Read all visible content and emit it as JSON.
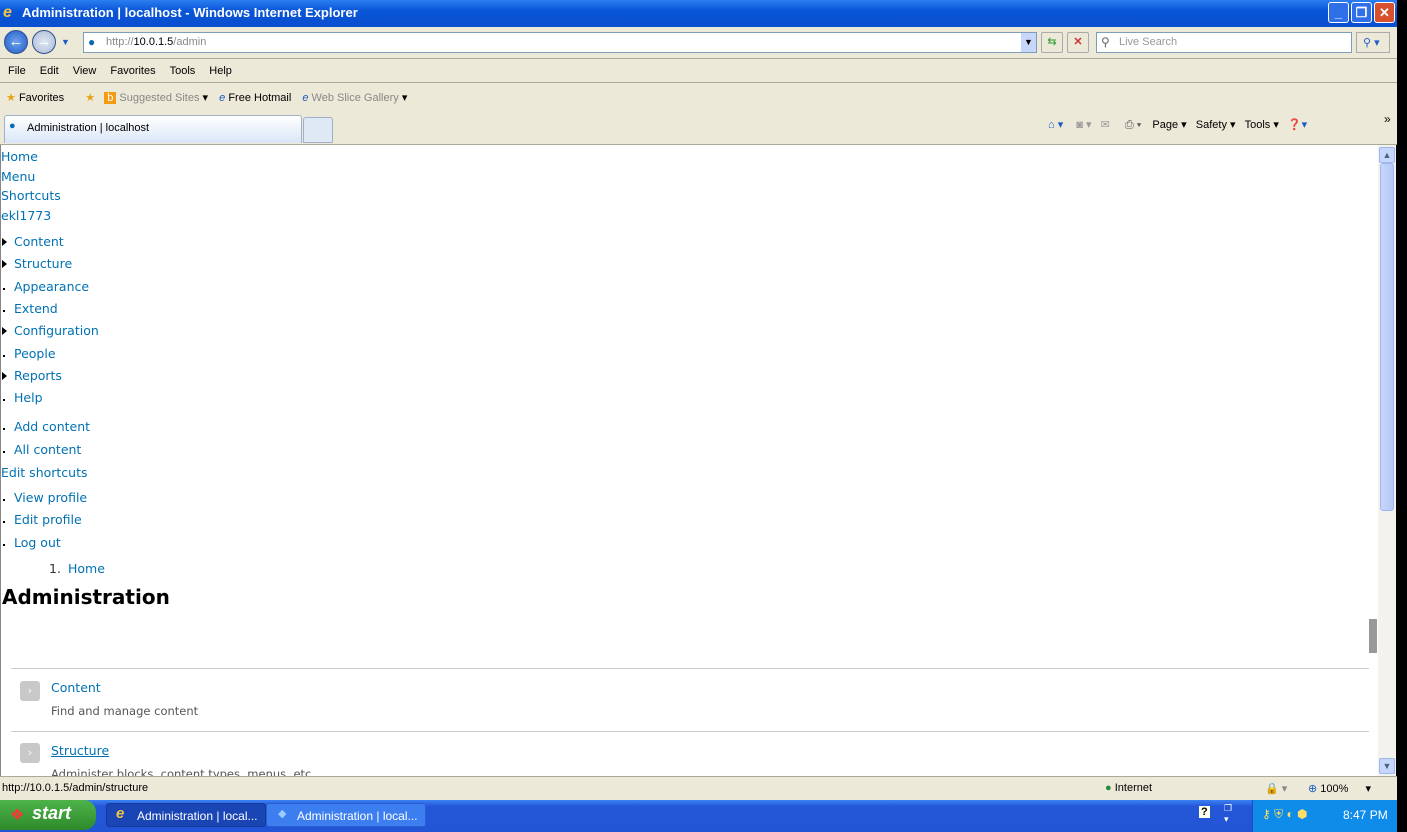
{
  "window": {
    "title": "Administration | localhost - Windows Internet Explorer"
  },
  "address": {
    "prefix": "http://",
    "host": "10.0.1.5",
    "path": "/admin"
  },
  "search": {
    "placeholder": "Live Search"
  },
  "menubar": [
    "File",
    "Edit",
    "View",
    "Favorites",
    "Tools",
    "Help"
  ],
  "favbar": {
    "favorites": "Favorites",
    "items": [
      "Suggested Sites",
      "Free Hotmail",
      "Web Slice Gallery"
    ]
  },
  "tab": {
    "label": "Administration | localhost"
  },
  "commandbar": [
    "Page",
    "Safety",
    "Tools"
  ],
  "page": {
    "toolbar_links": [
      "Home",
      "Menu",
      "Shortcuts",
      "ekl1773"
    ],
    "menu_items": [
      {
        "label": "Content",
        "expandable": true
      },
      {
        "label": "Structure",
        "expandable": true
      },
      {
        "label": "Appearance",
        "expandable": false
      },
      {
        "label": "Extend",
        "expandable": false
      },
      {
        "label": "Configuration",
        "expandable": true
      },
      {
        "label": "People",
        "expandable": false
      },
      {
        "label": "Reports",
        "expandable": true
      },
      {
        "label": "Help",
        "expandable": false
      }
    ],
    "shortcuts": [
      "Add content",
      "All content"
    ],
    "edit_shortcuts": "Edit shortcuts",
    "user_links": [
      "View profile",
      "Edit profile",
      "Log out"
    ],
    "breadcrumb_num": "1.",
    "breadcrumb": "Home",
    "title": "Administration",
    "admin_items": [
      {
        "title": "Content",
        "description": "Find and manage content"
      },
      {
        "title": "Structure",
        "description": "Administer blocks, content types, menus, etc."
      }
    ]
  },
  "status": {
    "url": "http://10.0.1.5/admin/structure",
    "zone": "Internet",
    "zoom": "100%"
  },
  "taskbar": {
    "start": "start",
    "tasks": [
      "Administration | local...",
      "Administration | local..."
    ],
    "clock": "8:47 PM"
  },
  "colors": {
    "link": "#0071b3",
    "titlebar": "#0955d8"
  }
}
